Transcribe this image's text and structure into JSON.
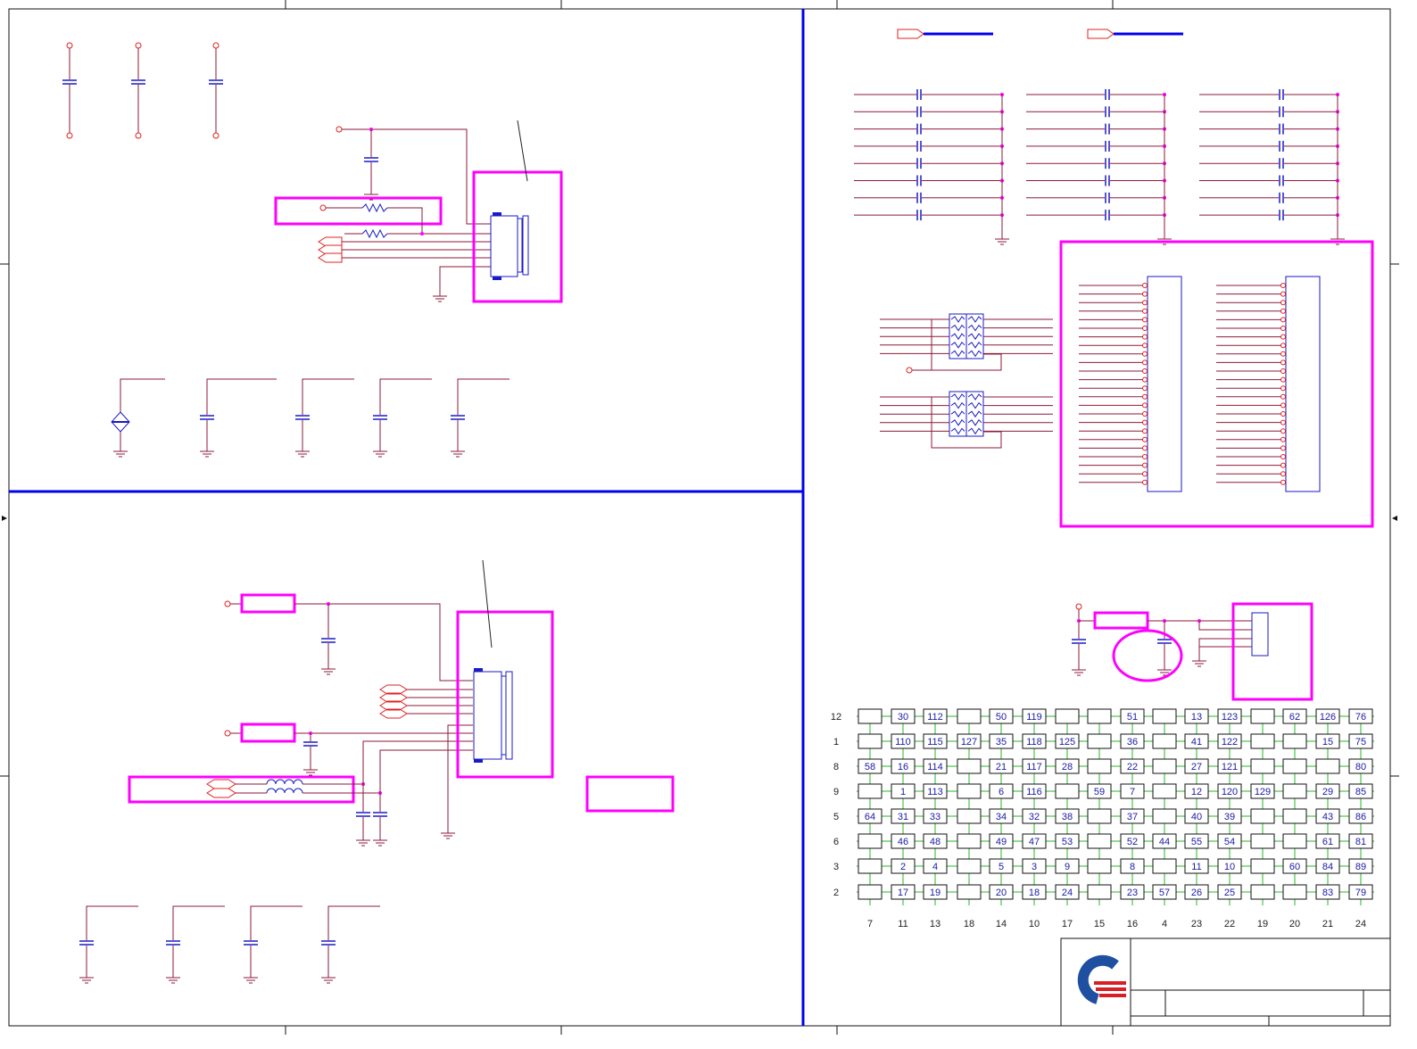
{
  "colors": {
    "wire": "#8b1a3a",
    "symbol": "#e02020",
    "cap": "#1a1ac8",
    "frame_divider": "#0000ee",
    "highlight": "#ff00ff",
    "matrix_box": "#111111",
    "matrix_grid": "#22bb22",
    "matrix_text": "#1a1aa6",
    "logo_blue": "#1f4fa0",
    "logo_red": "#d81f26"
  },
  "icons": {
    "logo": "company-logo-icon",
    "ground": "ground-icon",
    "capacitor": "capacitor-icon",
    "resistor": "resistor-icon",
    "inductor": "inductor-icon",
    "connector": "connector-icon",
    "resistor_network": "resistor-network-icon"
  },
  "keyboard_matrix": {
    "row_labels": [
      "12",
      "1",
      "8",
      "9",
      "5",
      "6",
      "3",
      "2"
    ],
    "column_labels": [
      "7",
      "11",
      "13",
      "18",
      "14",
      "10",
      "17",
      "15",
      "16",
      "4",
      "23",
      "22",
      "19",
      "20",
      "21",
      "24"
    ],
    "cells": [
      [
        "",
        "30",
        "112",
        "",
        "50",
        "119",
        "",
        "",
        "51",
        "",
        "13",
        "123",
        "",
        "62",
        "126",
        "76"
      ],
      [
        "",
        "110",
        "115",
        "127",
        "35",
        "118",
        "125",
        "",
        "36",
        "",
        "41",
        "122",
        "",
        "",
        "15",
        "75"
      ],
      [
        "58",
        "16",
        "114",
        "",
        "21",
        "117",
        "28",
        "",
        "22",
        "",
        "27",
        "121",
        "",
        "",
        "",
        "80"
      ],
      [
        "",
        "1",
        "113",
        "",
        "6",
        "116",
        "",
        "59",
        "7",
        "",
        "12",
        "120",
        "129",
        "",
        "29",
        "85"
      ],
      [
        "64",
        "31",
        "33",
        "",
        "34",
        "32",
        "38",
        "",
        "37",
        "",
        "40",
        "39",
        "",
        "",
        "43",
        "86"
      ],
      [
        "",
        "46",
        "48",
        "",
        "49",
        "47",
        "53",
        "",
        "52",
        "44",
        "55",
        "54",
        "",
        "",
        "61",
        "81"
      ],
      [
        "",
        "2",
        "4",
        "",
        "5",
        "3",
        "9",
        "",
        "8",
        "",
        "11",
        "10",
        "",
        "60",
        "84",
        "89"
      ],
      [
        "",
        "17",
        "19",
        "",
        "20",
        "18",
        "24",
        "",
        "23",
        "57",
        "26",
        "25",
        "",
        "",
        "83",
        "79"
      ]
    ]
  }
}
